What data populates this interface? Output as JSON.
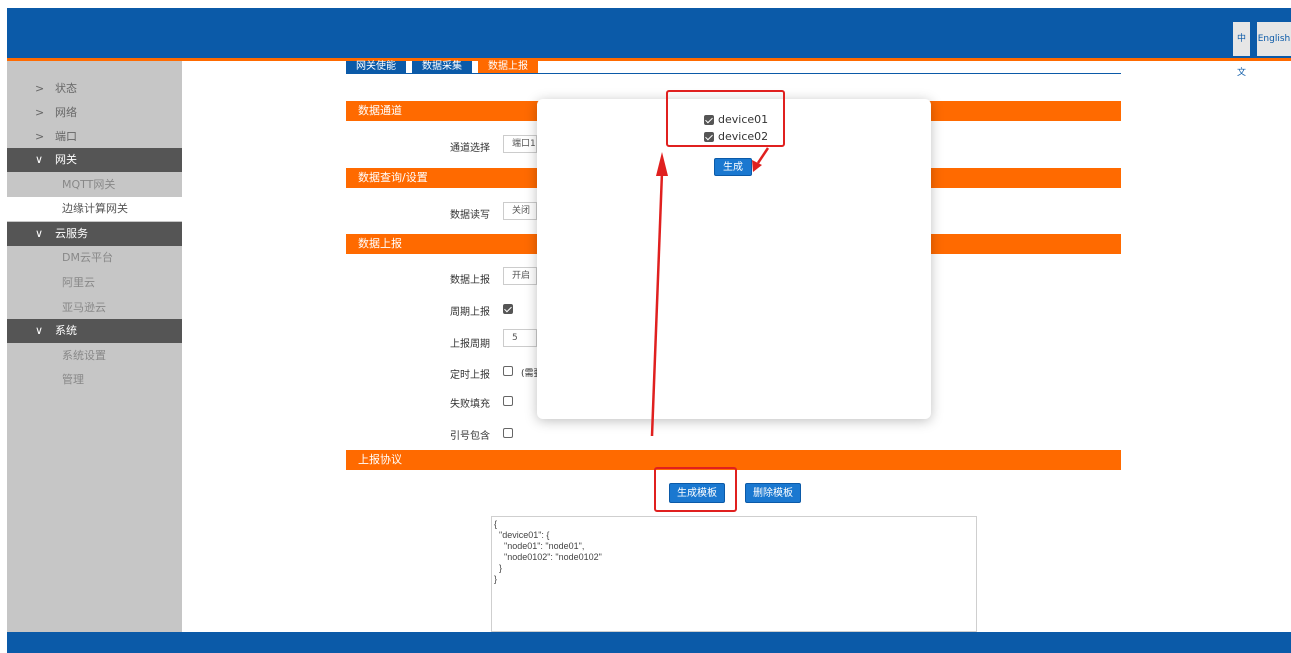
{
  "header": {
    "lang_zh": "中文",
    "lang_en": "English"
  },
  "sidebar": {
    "items": [
      {
        "arrow": ">",
        "label": "状态"
      },
      {
        "arrow": ">",
        "label": "网络"
      },
      {
        "arrow": ">",
        "label": "端口"
      },
      {
        "arrow": "∨",
        "label": "网关"
      },
      {
        "label": "MQTT网关"
      },
      {
        "label": "边缘计算网关"
      },
      {
        "arrow": "∨",
        "label": "云服务"
      },
      {
        "label": "DM云平台"
      },
      {
        "label": "阿里云"
      },
      {
        "label": "亚马逊云"
      },
      {
        "arrow": "∨",
        "label": "系统"
      },
      {
        "label": "系统设置"
      },
      {
        "label": "管理"
      }
    ]
  },
  "tabs": [
    "网关使能",
    "数据采集",
    "数据上报"
  ],
  "sections": {
    "channel": "数据通道",
    "query": "数据查询/设置",
    "report": "数据上报",
    "protocol": "上报协议"
  },
  "fields": {
    "channel_select": {
      "label": "通道选择",
      "value": "端口1"
    },
    "data_rw": {
      "label": "数据读写",
      "value": "关闭"
    },
    "data_report": {
      "label": "数据上报",
      "value": "开启"
    },
    "periodic_report": {
      "label": "周期上报",
      "checked": true
    },
    "report_period": {
      "label": "上报周期",
      "value": "5"
    },
    "timed_report": {
      "label": "定时上报",
      "checked": false,
      "note": "(需要"
    },
    "fail_fill": {
      "label": "失败填充",
      "checked": false
    },
    "quote_include": {
      "label": "引号包含",
      "checked": false
    }
  },
  "buttons": {
    "generate_template": "生成模板",
    "delete_template": "删除模板"
  },
  "template_json": "{\n  \"device01\": {\n    \"node01\": \"node01\",\n    \"node0102\": \"node0102\"\n  }\n}",
  "modal": {
    "options": [
      {
        "label": "device01",
        "checked": true
      },
      {
        "label": "device02",
        "checked": true
      }
    ],
    "generate_label": "生成"
  },
  "colors": {
    "header_blue": "#0b5aa8",
    "accent_orange": "#ff6a00",
    "annotation_red": "#e0201f"
  }
}
